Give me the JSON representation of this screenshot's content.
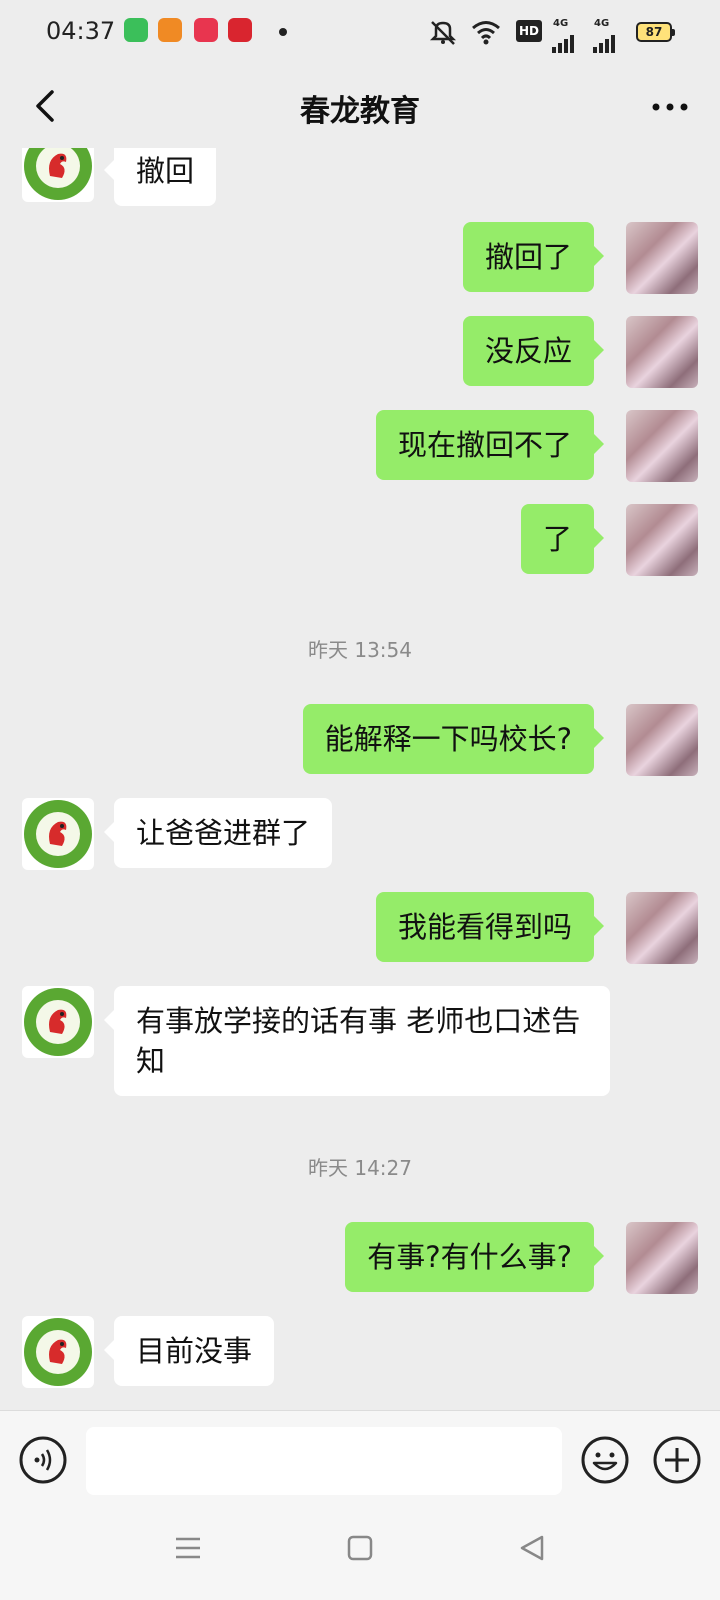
{
  "status_bar": {
    "time": "04:37",
    "battery": "87",
    "network_1": "4G",
    "network_2": "4G",
    "hd": "HD"
  },
  "header": {
    "title": "春龙教育"
  },
  "messages": [
    {
      "side": "in",
      "text": "撤回"
    },
    {
      "side": "out",
      "text": "撤回了"
    },
    {
      "side": "out",
      "text": "没反应"
    },
    {
      "side": "out",
      "text": "现在撤回不了"
    },
    {
      "side": "out",
      "text": "了"
    },
    {
      "timestamp": "昨天 13:54"
    },
    {
      "side": "out",
      "text": "能解释一下吗校长?"
    },
    {
      "side": "in",
      "text": "让爸爸进群了"
    },
    {
      "side": "out",
      "text": "我能看得到吗"
    },
    {
      "side": "in",
      "text": "有事放学接的话有事 老师也口述告知"
    },
    {
      "timestamp": "昨天 14:27"
    },
    {
      "side": "out",
      "text": "有事?有什么事?"
    },
    {
      "side": "in",
      "text": "目前没事"
    }
  ],
  "input": {
    "value": "",
    "placeholder": ""
  },
  "icons": {
    "back": "chevron-left-icon",
    "more": "more-horizontal-icon",
    "voice": "voice-icon",
    "emoji": "emoji-icon",
    "plus": "plus-icon"
  },
  "colors": {
    "background": "#ededed",
    "outgoing_bubble": "#95ec69",
    "incoming_bubble": "#ffffff"
  }
}
